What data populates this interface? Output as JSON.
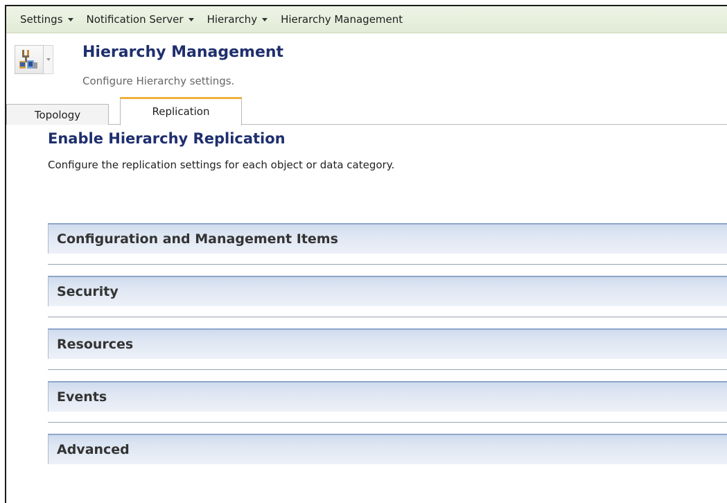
{
  "menubar": {
    "items": [
      {
        "label": "Settings",
        "dropdown": true
      },
      {
        "label": "Notification Server",
        "dropdown": true
      },
      {
        "label": "Hierarchy",
        "dropdown": true
      },
      {
        "label": "Hierarchy Management",
        "dropdown": false
      }
    ]
  },
  "header": {
    "icon": "hierarchy-icon",
    "title": "Hierarchy Management",
    "subtitle": "Configure Hierarchy settings."
  },
  "tabs": [
    {
      "label": "Topology",
      "active": false
    },
    {
      "label": "Replication",
      "active": true
    }
  ],
  "section": {
    "title": "Enable Hierarchy Replication",
    "description": "Configure the replication settings for each object or data category."
  },
  "panels": [
    {
      "label": "Configuration and Management Items"
    },
    {
      "label": "Security"
    },
    {
      "label": "Resources"
    },
    {
      "label": "Events"
    },
    {
      "label": "Advanced"
    }
  ],
  "colors": {
    "accent_tab": "#f0b03a",
    "title_blue": "#1f2f6e",
    "panel_header": "#dfe7f3"
  }
}
